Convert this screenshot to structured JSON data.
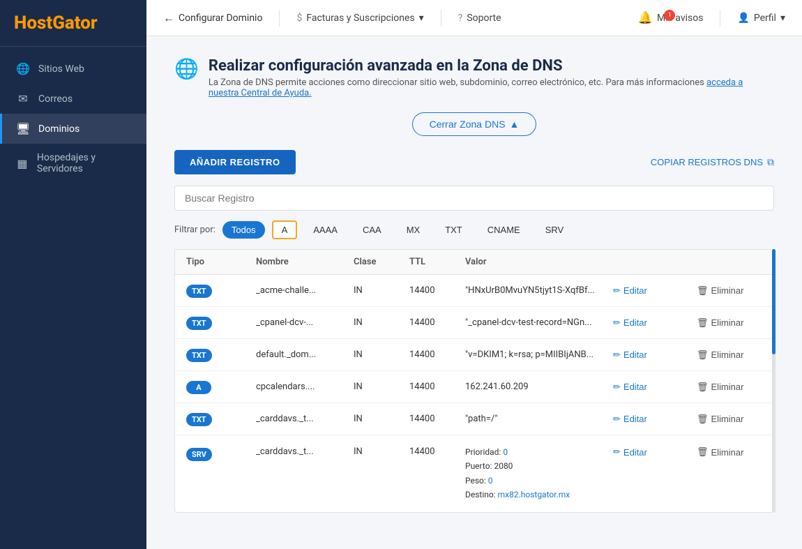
{
  "app": {
    "logo_text_1": "Host",
    "logo_text_2": "Gator"
  },
  "sidebar": {
    "items": [
      {
        "id": "sitios-web",
        "label": "Sitios Web",
        "icon": "🌐",
        "active": false
      },
      {
        "id": "correos",
        "label": "Correos",
        "icon": "✉️",
        "active": false
      },
      {
        "id": "dominios",
        "label": "Dominios",
        "icon": "🖥️",
        "active": true
      },
      {
        "id": "hospedajes",
        "label": "Hospedajes y Servidores",
        "icon": "📦",
        "active": false
      }
    ]
  },
  "topnav": {
    "back_label": "Configurar Dominio",
    "billing_label": "Facturas y Suscripciones",
    "support_label": "Soporte",
    "notifications_label": "Mis avisos",
    "notifications_badge": "1",
    "profile_label": "Perfil"
  },
  "dns_zone": {
    "title": "Realizar configuración avanzada en la Zona de DNS",
    "description": "La Zona de DNS permite acciones como direccionar sitio web, subdominio, correo electrónico, etc. Para más informaciones",
    "help_link": "acceda a nuestra Central de Ayuda.",
    "close_btn": "Cerrar Zona DNS",
    "add_record_btn": "AÑADIR REGISTRO",
    "copy_btn": "COPIAR REGISTROS DNS",
    "search_placeholder": "Buscar Registro",
    "filter_label": "Filtrar por:",
    "filters": [
      "Todos",
      "A",
      "AAAA",
      "CAA",
      "MX",
      "TXT",
      "CNAME",
      "SRV"
    ],
    "active_filter": "Todos",
    "highlighted_filter": "A",
    "table_headers": [
      "Tipo",
      "Nombre",
      "Clase",
      "TTL",
      "Valor",
      "",
      ""
    ],
    "records": [
      {
        "type": "TXT",
        "type_badge": "badge-txt",
        "name": "_acme-challe...",
        "class": "IN",
        "ttl": "14400",
        "value": "\"HNxUrB0MvuYN5tjyt1S-XqfBf...",
        "edit_label": "Editar",
        "delete_label": "Eliminar"
      },
      {
        "type": "TXT",
        "type_badge": "badge-txt",
        "name": "_cpanel-dcv-...",
        "class": "IN",
        "ttl": "14400",
        "value": "\"_cpanel-dcv-test-record=NGn...",
        "edit_label": "Editar",
        "delete_label": "Eliminar"
      },
      {
        "type": "TXT",
        "type_badge": "badge-txt",
        "name": "default._dom...",
        "class": "IN",
        "ttl": "14400",
        "value": "\"v=DKIM1; k=rsa; p=MIIBIjANB...",
        "edit_label": "Editar",
        "delete_label": "Eliminar"
      },
      {
        "type": "A",
        "type_badge": "badge-a",
        "name": "cpcalendars....",
        "class": "IN",
        "ttl": "14400",
        "value": "162.241.60.209",
        "edit_label": "Editar",
        "delete_label": "Eliminar"
      },
      {
        "type": "TXT",
        "type_badge": "badge-txt",
        "name": "_carddavs._t...",
        "class": "IN",
        "ttl": "14400",
        "value": "\"path=/\"",
        "edit_label": "Editar",
        "delete_label": "Eliminar"
      },
      {
        "type": "SRV",
        "type_badge": "badge-srv",
        "name": "_carddavs._t...",
        "class": "IN",
        "ttl": "14400",
        "value_lines": [
          {
            "label": "Prioridad:",
            "val": "0",
            "is_link": true
          },
          {
            "label": "Puerto:",
            "val": "2080",
            "is_link": false
          },
          {
            "label": "Peso:",
            "val": "0",
            "is_link": true
          },
          {
            "label": "Destino:",
            "val": "mx82.hostgator.mx",
            "is_link": true
          }
        ],
        "edit_label": "Editar",
        "delete_label": "Eliminar"
      }
    ]
  }
}
